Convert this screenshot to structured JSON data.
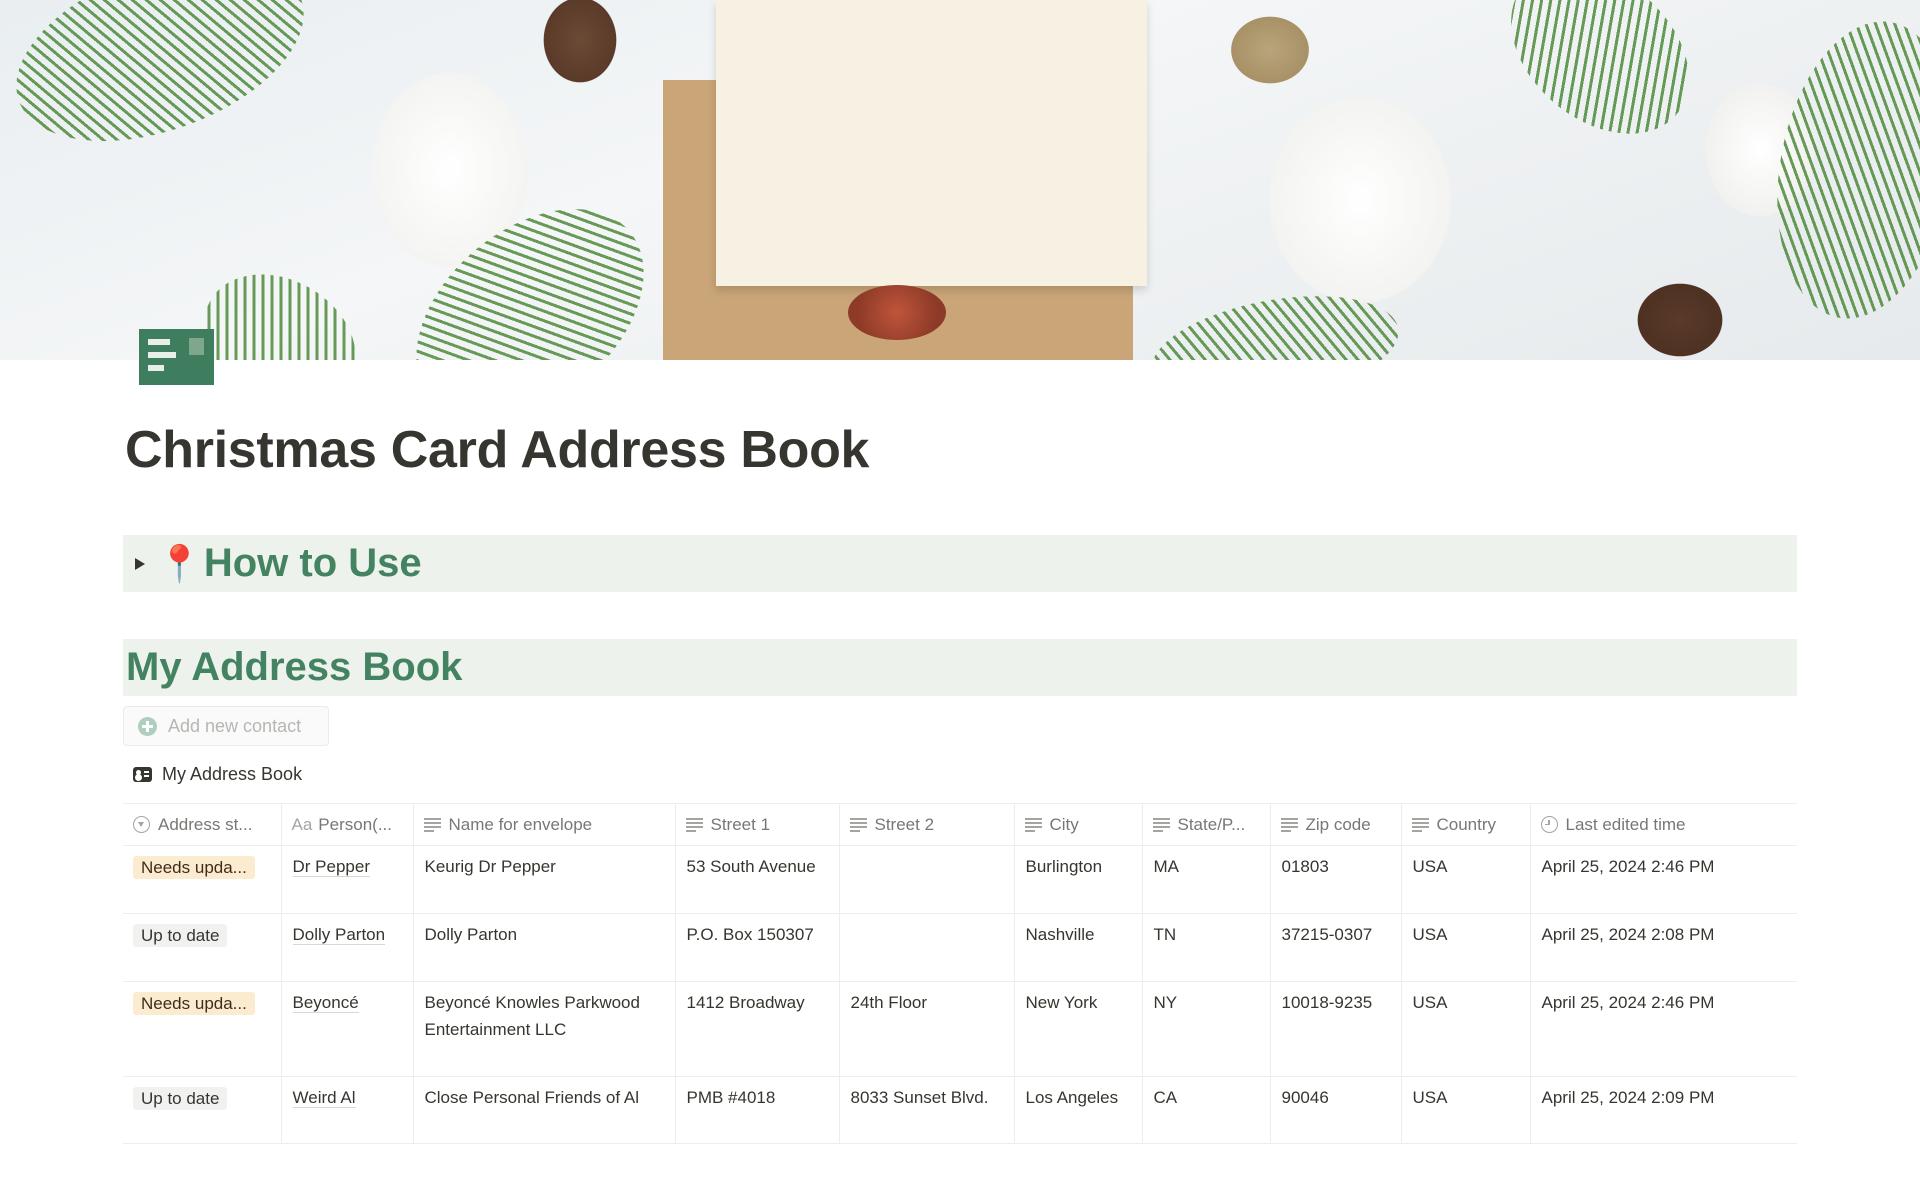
{
  "page": {
    "title": "Christmas Card Address Book",
    "cover": "christmas-cover-image",
    "icon": "postcard-icon"
  },
  "toggle": {
    "emoji": "📍",
    "title": "How to Use",
    "expanded": false
  },
  "section": {
    "title": "My Address Book"
  },
  "add_button": {
    "label": "Add new contact",
    "icon": "plus-circle-icon"
  },
  "database": {
    "title": "My Address Book",
    "icon": "contact-card-icon",
    "columns": [
      {
        "label": "Address st...",
        "icon": "select-icon"
      },
      {
        "label": "Person(...",
        "icon": "title-icon"
      },
      {
        "label": "Name for envelope",
        "icon": "text-icon"
      },
      {
        "label": "Street 1",
        "icon": "text-icon"
      },
      {
        "label": "Street 2",
        "icon": "text-icon"
      },
      {
        "label": "City",
        "icon": "text-icon"
      },
      {
        "label": "State/P...",
        "icon": "text-icon"
      },
      {
        "label": "Zip code",
        "icon": "text-icon"
      },
      {
        "label": "Country",
        "icon": "text-icon"
      },
      {
        "label": "Last edited time",
        "icon": "clock-icon"
      }
    ],
    "rows": [
      {
        "status": "Needs upda...",
        "status_color": "#fbecd0",
        "person": "Dr Pepper",
        "envelope_name": "Keurig Dr Pepper",
        "street1": "53 South Avenue",
        "street2": "",
        "city": "Burlington",
        "state": "MA",
        "zip": "01803",
        "country": "USA",
        "last_edited": "April 25, 2024 2:46 PM"
      },
      {
        "status": "Up to date",
        "status_color": "#f1f1ef",
        "person": "Dolly Parton",
        "envelope_name": "Dolly Parton",
        "street1": "P.O. Box 150307",
        "street2": "",
        "city": "Nashville",
        "state": "TN",
        "zip": "37215-0307",
        "country": "USA",
        "last_edited": "April 25, 2024 2:08 PM"
      },
      {
        "status": "Needs upda...",
        "status_color": "#fbecd0",
        "person": "Beyoncé",
        "envelope_name": "Beyoncé Knowles Parkwood Entertainment LLC",
        "street1": "1412 Broadway",
        "street2": "24th Floor",
        "city": "New York",
        "state": "NY",
        "zip": "10018-9235",
        "country": "USA",
        "last_edited": "April 25, 2024 2:46 PM"
      },
      {
        "status": "Up to date",
        "status_color": "#f1f1ef",
        "person": "Weird Al",
        "envelope_name": "Close Personal Friends of Al",
        "street1": "PMB #4018",
        "street2": "8033 Sunset Blvd.",
        "city": "Los Angeles",
        "state": "CA",
        "zip": "90046",
        "country": "USA",
        "last_edited": "April 25, 2024 2:09 PM"
      }
    ]
  },
  "colors": {
    "accent_green": "#448361",
    "heading_bg": "#edf3ec",
    "icon_green": "#3e7e5e"
  }
}
